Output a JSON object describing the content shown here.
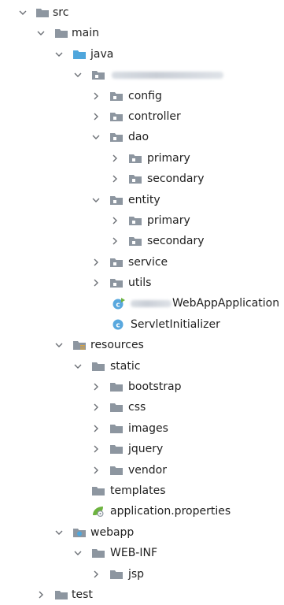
{
  "tree": {
    "src": "src",
    "main": "main",
    "java": "java",
    "config": "config",
    "controller": "controller",
    "dao": "dao",
    "dao_primary": "primary",
    "dao_secondary": "secondary",
    "entity": "entity",
    "entity_primary": "primary",
    "entity_secondary": "secondary",
    "service": "service",
    "utils": "utils",
    "app_class_suffix": "WebAppApplication",
    "servlet_initializer": "ServletInitializer",
    "resources": "resources",
    "static": "static",
    "bootstrap": "bootstrap",
    "css": "css",
    "images": "images",
    "jquery": "jquery",
    "vendor": "vendor",
    "templates": "templates",
    "application_properties": "application.properties",
    "webapp": "webapp",
    "web_inf": "WEB-INF",
    "jsp": "jsp",
    "test": "test"
  },
  "colors": {
    "folder": "#8d96a0",
    "folder_source": "#4fa6dc",
    "class_circle": "#59a8de",
    "chevron": "#6b6f75",
    "spring_leaf": "#6db33f"
  },
  "icons": {
    "folder": "folder-icon",
    "source_folder": "source-root-folder-icon",
    "resources_folder": "resources-folder-icon",
    "webapp_folder": "web-folder-icon",
    "package": "package-icon",
    "class": "class-icon",
    "spring_boot_class": "spring-boot-application-icon",
    "properties": "spring-properties-icon"
  }
}
